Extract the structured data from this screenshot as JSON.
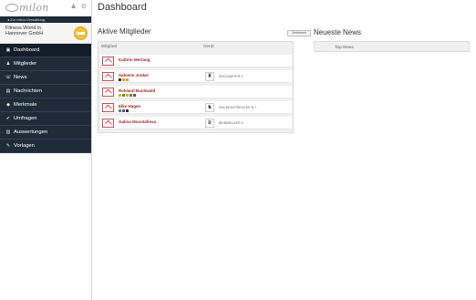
{
  "app": {
    "logo": "milon"
  },
  "sidebar": {
    "back_link": "◂ Zur milon-Verwaltung",
    "club_name_line1": "Fitness World in",
    "club_name_line2": "Hannover GmbH",
    "items": [
      {
        "icon": "▣",
        "label": "Dashboard",
        "icon_name": "dashboard-icon"
      },
      {
        "icon": "♟",
        "label": "Mitglieder",
        "icon_name": "user-icon"
      },
      {
        "icon": "☏",
        "label": "News",
        "icon_name": "megaphone-icon"
      },
      {
        "icon": "▤",
        "label": "Nachrichten",
        "icon_name": "message-icon"
      },
      {
        "icon": "◆",
        "label": "Merkmale",
        "icon_name": "tag-icon"
      },
      {
        "icon": "✔",
        "label": "Umfragen",
        "icon_name": "check-icon"
      },
      {
        "icon": "▥",
        "label": "Auswertungen",
        "icon_name": "chart-icon"
      },
      {
        "icon": "✎",
        "label": "Vorlagen",
        "icon_name": "pencil-icon"
      }
    ]
  },
  "main": {
    "title": "Dashboard",
    "active_members": {
      "title": "Aktive Mitglieder",
      "button": "Zentrieren",
      "col_member": "Mitglied",
      "col_device": "Gerät",
      "rows": [
        {
          "name": "Kathrin Mertang",
          "device": "",
          "dots": []
        },
        {
          "name": "Sabiene Junker",
          "device": "ERGOMETER 4",
          "dots": [
            "#333333",
            "#f0a020",
            "#f0a020"
          ]
        },
        {
          "name": "Rehland Buchwald",
          "device": "",
          "dots": [
            "#f0a020",
            "#3a9a3a",
            "#f0a020",
            "#3a9a3a",
            "#7a3aa0"
          ]
        },
        {
          "name": "Elke Hagen",
          "device": "RÜCKENSTRECKER B 7",
          "dots": [
            "#3a9a3a",
            "#7a3aa0",
            "#333333"
          ]
        },
        {
          "name": "Galina Moustafieva",
          "device": "BEINBEUGER 5",
          "dots": []
        }
      ]
    },
    "news": {
      "title": "Neueste News",
      "top_label": "Top News"
    }
  }
}
